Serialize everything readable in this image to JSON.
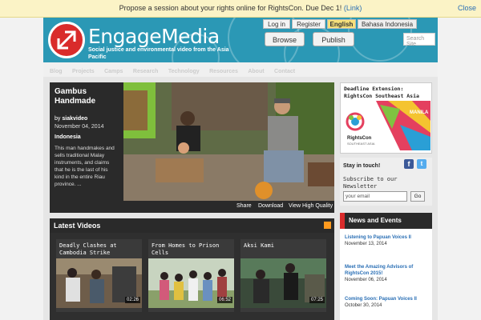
{
  "topbar": {
    "message": "Propose a session about your rights online for RightsCon. Due Dec 1!",
    "link": "(Link)",
    "close": "Close"
  },
  "header": {
    "brand": "EngageMedia",
    "tagline": "Social justice and environmental video from the Asia Pacific",
    "login": "Log in",
    "register": "Register",
    "lang_en": "English",
    "lang_id": "Bahasa Indonesia",
    "browse": "Browse",
    "publish": "Publish",
    "search_placeholder": "Search Site"
  },
  "nav": {
    "items": [
      "Blog",
      "Projects",
      "Camps",
      "Research",
      "Technology",
      "Resources",
      "About",
      "Contact"
    ]
  },
  "feature": {
    "title": "Gambus Handmade",
    "by_prefix": "by",
    "author": "siakvideo",
    "date": "November 04, 2014",
    "country": "Indonesia",
    "description": "This man handmakes and sells traditional Malay instruments, and claims that he is the last of his kind in the entire Riau province. ...",
    "share": "Share",
    "download": "Download",
    "hq": "View High Quality"
  },
  "latest": {
    "heading": "Latest Videos",
    "cards": [
      {
        "title": "Deadly Clashes at Cambodia Strike",
        "duration": "02:26"
      },
      {
        "title": "From Homes to Prison Cells",
        "duration": "06:52"
      },
      {
        "title": "Aksi Kami",
        "duration": "07:25"
      }
    ]
  },
  "sidebar": {
    "deadline": "Deadline Extension: RightsCon Southeast Asia",
    "banner_text": "RightsCon",
    "banner_sub": "SOUTHEAST ASIA",
    "banner_city": "MANILA",
    "stay_title": "Stay in touch!",
    "subscribe": "Subscribe to our Newsletter",
    "email_placeholder": "your email",
    "go": "Go"
  },
  "news": {
    "heading": "News and Events",
    "items": [
      {
        "title": "Listening to Papuan Voices II",
        "date": "November 13, 2014"
      },
      {
        "title": "Meet the Amazing Advisors of RightsCon 2015!",
        "date": "November 06, 2014"
      },
      {
        "title": "Coming Soon: Papuan Voices II",
        "date": "October 30, 2014"
      }
    ]
  },
  "colors": {
    "header_bg": "#2b98b5",
    "logo_red": "#d92b2b",
    "link_blue": "#2a6fb5",
    "lang_highlight": "#f6e07a"
  }
}
